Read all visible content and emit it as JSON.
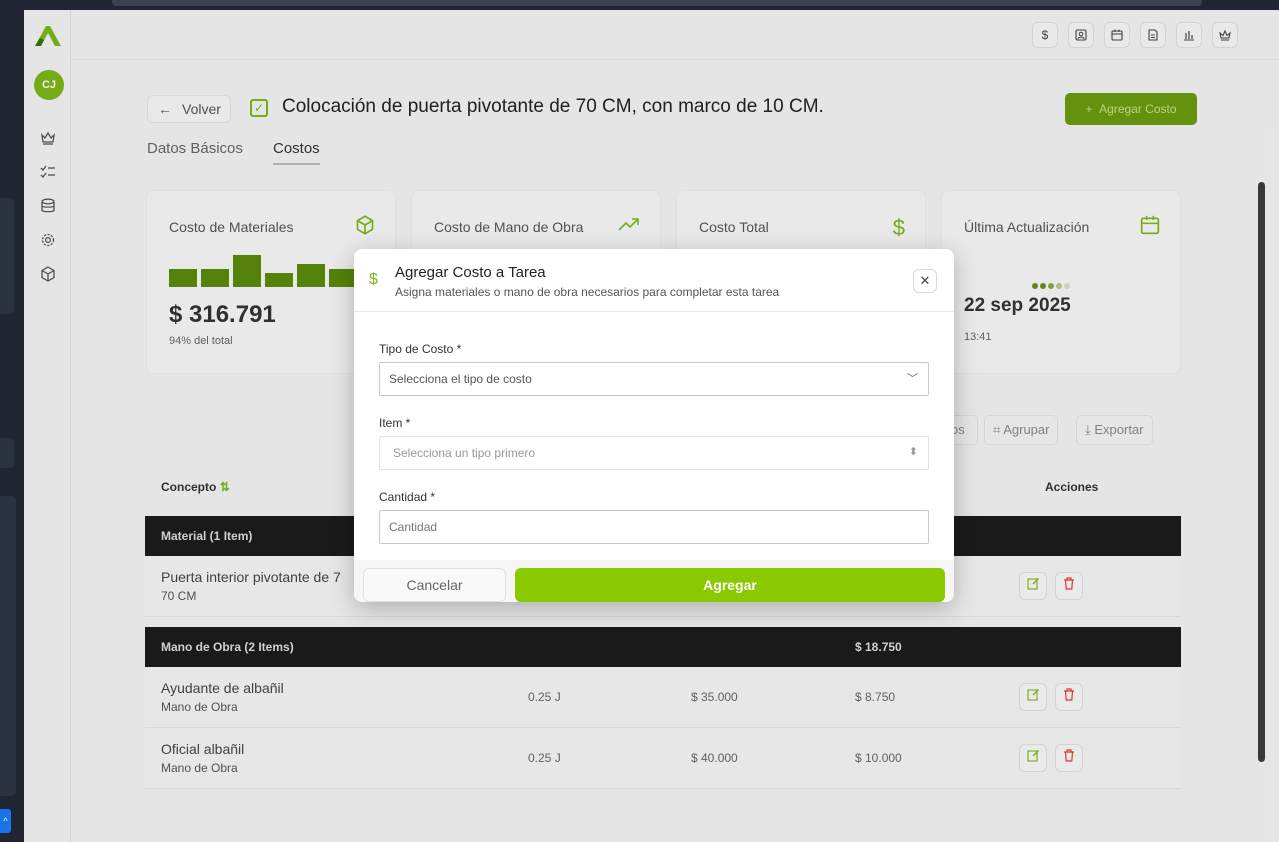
{
  "header": {
    "toolbar_icons": [
      "dollar-icon",
      "contact-icon",
      "calendar-icon",
      "document-icon",
      "bar-chart-icon",
      "crown-icon"
    ]
  },
  "sidebar": {
    "avatar_initials": "CJ",
    "items": [
      "crown-icon",
      "checklist-icon",
      "database-icon",
      "gear-icon",
      "cube-icon"
    ]
  },
  "page": {
    "back_label": "Volver",
    "title": "Colocación de puerta pivotante de 70 CM, con marco de 10 CM.",
    "add_cost_label": "Agregar Costo",
    "tabs": [
      {
        "label": "Datos Básicos",
        "active": false
      },
      {
        "label": "Costos",
        "active": true
      }
    ]
  },
  "stats": [
    {
      "label": "Costo de Materiales",
      "value": "$ 316.791",
      "detail": "94% del total"
    },
    {
      "label": "Costo de Mano de Obra",
      "value": "",
      "detail": ""
    },
    {
      "label": "Costo Total",
      "value": "",
      "detail": ""
    },
    {
      "label": "Última Actualización",
      "value": "22 sep 2025",
      "detail": "13:41"
    }
  ],
  "toolbar": {
    "filter_partial": "os",
    "group_label": "Agrupar",
    "export_label": "Exportar"
  },
  "table": {
    "headers": {
      "concept": "Concepto",
      "actions": "Acciones"
    },
    "groups": [
      {
        "title": "Material (1 Item)",
        "total": "",
        "rows": [
          {
            "name": "Puerta interior pivotante de 7",
            "sub": "70 CM",
            "qty": "",
            "unit": "",
            "total": ""
          }
        ]
      },
      {
        "title": "Mano de Obra (2 Items)",
        "total": "$ 18.750",
        "rows": [
          {
            "name": "Ayudante de albañil",
            "sub": "Mano de Obra",
            "qty": "0.25 J",
            "unit": "$ 35.000",
            "total": "$ 8.750"
          },
          {
            "name": "Oficial albañil",
            "sub": "Mano de Obra",
            "qty": "0.25 J",
            "unit": "$ 40.000",
            "total": "$ 10.000"
          }
        ]
      }
    ]
  },
  "modal": {
    "title": "Agregar Costo a Tarea",
    "subtitle": "Asigna materiales o mano de obra necesarios para completar esta tarea",
    "fields": {
      "cost_type": {
        "label": "Tipo de Costo *",
        "placeholder": "Selecciona el tipo de costo"
      },
      "item": {
        "label": "Item *",
        "placeholder": "Selecciona un tipo primero"
      },
      "quantity": {
        "label": "Cantidad *",
        "placeholder": "Cantidad"
      }
    },
    "cancel_label": "Cancelar",
    "submit_label": "Agregar"
  },
  "colors": {
    "accent": "#8ac800",
    "accent_dark": "#6a9a10",
    "danger": "#e53935",
    "group_row_bg": "#1c1c1c"
  }
}
